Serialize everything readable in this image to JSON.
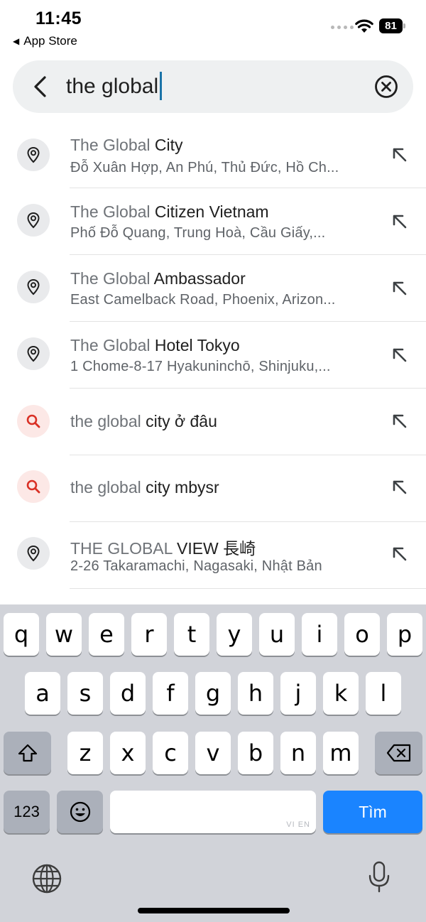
{
  "status_bar": {
    "time": "11:45",
    "back_app": "App Store",
    "battery": "81"
  },
  "search": {
    "query": "the global"
  },
  "results": [
    {
      "type": "place",
      "title_match": "The Global",
      "title_rest": " City",
      "subtitle": "Đỗ Xuân Hợp, An Phú, Thủ Đức, Hồ Ch..."
    },
    {
      "type": "place",
      "title_match": "The Global",
      "title_rest": " Citizen Vietnam",
      "subtitle": "Phố Đỗ Quang, Trung Hoà, Cầu Giấy,..."
    },
    {
      "type": "place",
      "title_match": "The Global",
      "title_rest": " Ambassador",
      "subtitle": "East Camelback Road, Phoenix, Arizon..."
    },
    {
      "type": "place",
      "title_match": "The Global",
      "title_rest": " Hotel Tokyo",
      "subtitle": "1 Chome-8-17 Hyakuninchō, Shinjuku,..."
    },
    {
      "type": "query",
      "title_match": "the global",
      "title_rest": " city ở đâu",
      "subtitle": ""
    },
    {
      "type": "query",
      "title_match": "the global",
      "title_rest": " city mbysr",
      "subtitle": ""
    },
    {
      "type": "place",
      "title_match": "THE GLOBAL",
      "title_rest": " VIEW 長崎",
      "subtitle": "2-26 Takaramachi, Nagasaki, Nhật Bản"
    }
  ],
  "keyboard": {
    "row1": [
      "q",
      "w",
      "e",
      "r",
      "t",
      "y",
      "u",
      "i",
      "o",
      "p"
    ],
    "row2": [
      "a",
      "s",
      "d",
      "f",
      "g",
      "h",
      "j",
      "k",
      "l"
    ],
    "row3": [
      "z",
      "x",
      "c",
      "v",
      "b",
      "n",
      "m"
    ],
    "numbers_key": "123",
    "space_hint": "VI EN",
    "go_key": "Tìm"
  },
  "colors": {
    "accent": "#1a84ff",
    "query_icon": "#d93025",
    "caret": "#1a73a8"
  }
}
